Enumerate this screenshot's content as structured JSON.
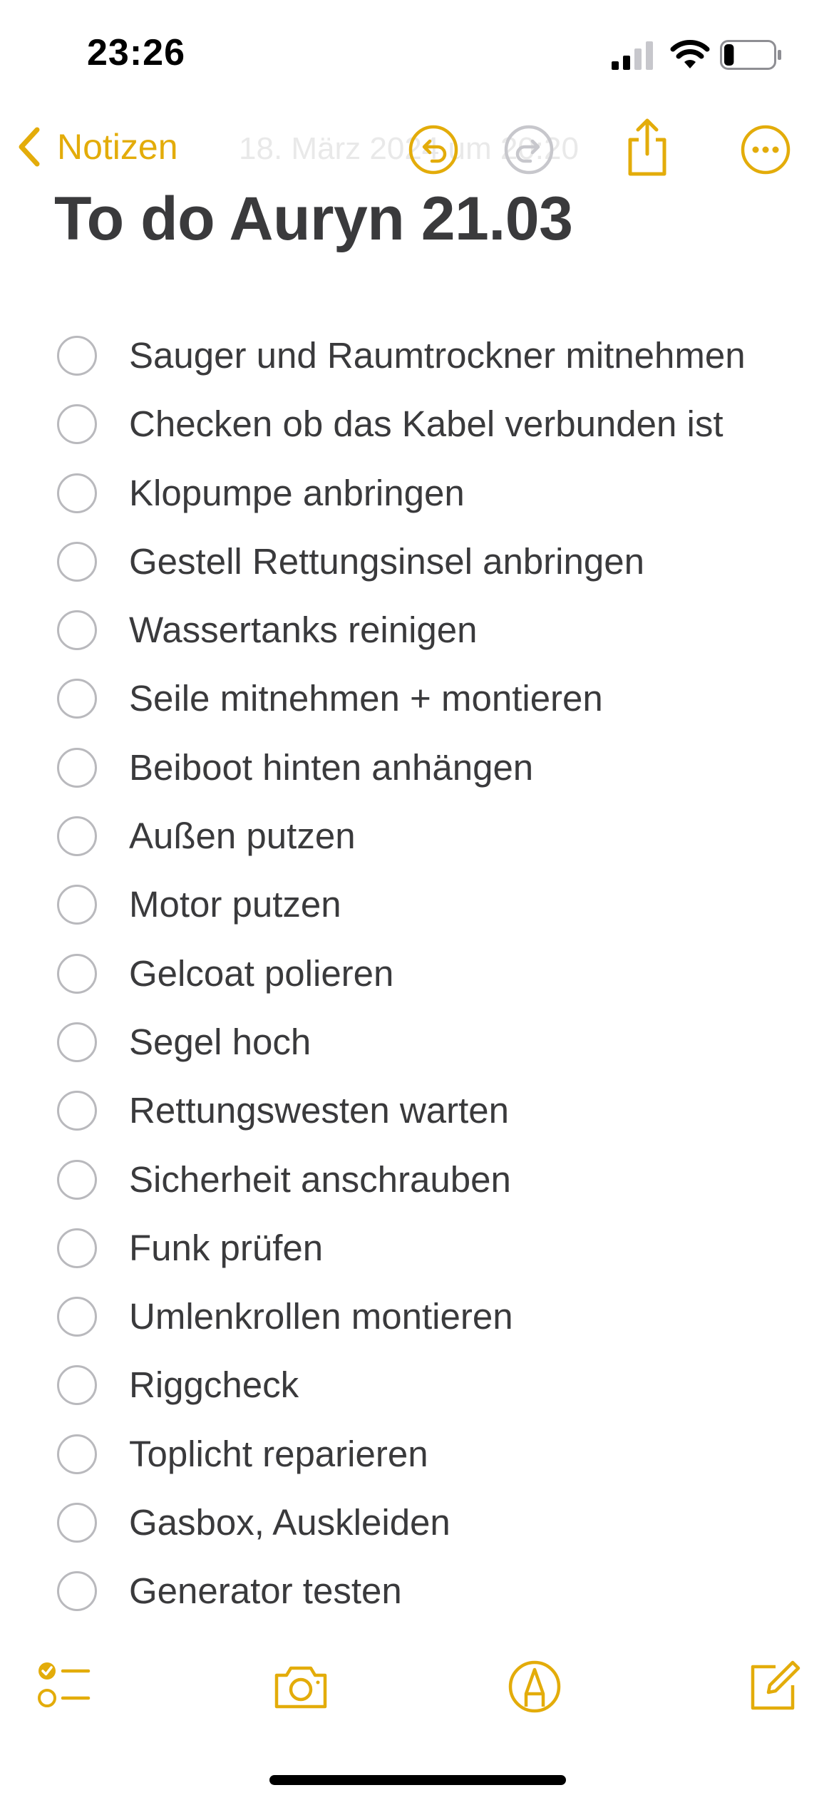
{
  "status_bar": {
    "time": "23:26",
    "signal_icon": "cellular-signal-icon",
    "wifi_icon": "wifi-icon",
    "battery_icon": "battery-icon",
    "battery_level": 0.2
  },
  "nav": {
    "back_label": "Notizen",
    "date_text": "18. März 2024 um 20:20",
    "icons": [
      "undo-icon",
      "redo-icon",
      "share-icon",
      "more-icon"
    ]
  },
  "note": {
    "title": "To do Auryn 21.03",
    "items": [
      "Sauger und Raumtrockner mitnehmen",
      "Checken ob das Kabel verbunden ist",
      "Klopumpe anbringen",
      "Gestell Rettungsinsel anbringen",
      "Wassertanks reinigen",
      "Seile mitnehmen + montieren",
      "Beiboot hinten anhängen",
      "Außen putzen",
      "Motor putzen",
      "Gelcoat polieren",
      "Segel hoch",
      "Rettungswesten warten",
      "Sicherheit anschrauben",
      "Funk prüfen",
      "Umlenkrollen montieren",
      "Riggcheck",
      "Toplicht reparieren",
      "Gasbox, Auskleiden",
      "Generator testen"
    ]
  },
  "toolbar": {
    "icons": [
      "checklist-icon",
      "camera-icon",
      "markup-icon",
      "compose-icon"
    ]
  },
  "colors": {
    "accent": "#E3AC0A",
    "text": "#3A3A3C",
    "redo_disabled": "#C7C7CC",
    "circle": "#B9B9BD"
  }
}
